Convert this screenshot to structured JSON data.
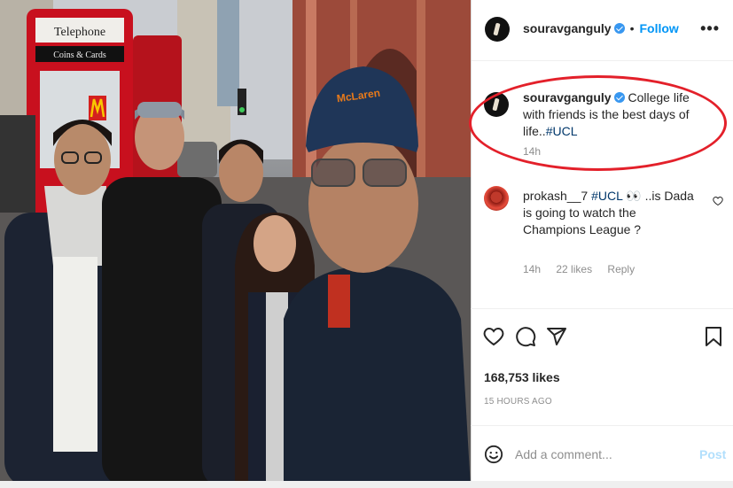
{
  "post": {
    "author": "souravganguly",
    "follow_label": "Follow",
    "more_label": "•••",
    "caption": {
      "username": "souravganguly",
      "text": "College life with friends is the best days of life..",
      "hashtag": "#UCL",
      "time": "14h"
    },
    "comment": {
      "username": "prokash__7",
      "hashtag": "#UCL",
      "emoji": "👀",
      "text": "..is Dada is going to watch the Champions League ?",
      "time": "14h",
      "likes": "22 likes",
      "reply_label": "Reply"
    },
    "likes_count": "168,753 likes",
    "posted_ago": "15 HOURS AGO",
    "add_comment_placeholder": "Add a comment...",
    "post_label": "Post"
  },
  "photo": {
    "booth_sign": "Telephone",
    "booth_sub": "Coins & Cards",
    "cap_text": "McLaren"
  },
  "colors": {
    "accent": "#0095f6",
    "highlight": "#e3202a",
    "verified": "#3897f0"
  },
  "icons": [
    "heart-icon",
    "comment-icon",
    "share-icon",
    "bookmark-icon",
    "emoji-icon",
    "more-icon",
    "verified-icon"
  ]
}
